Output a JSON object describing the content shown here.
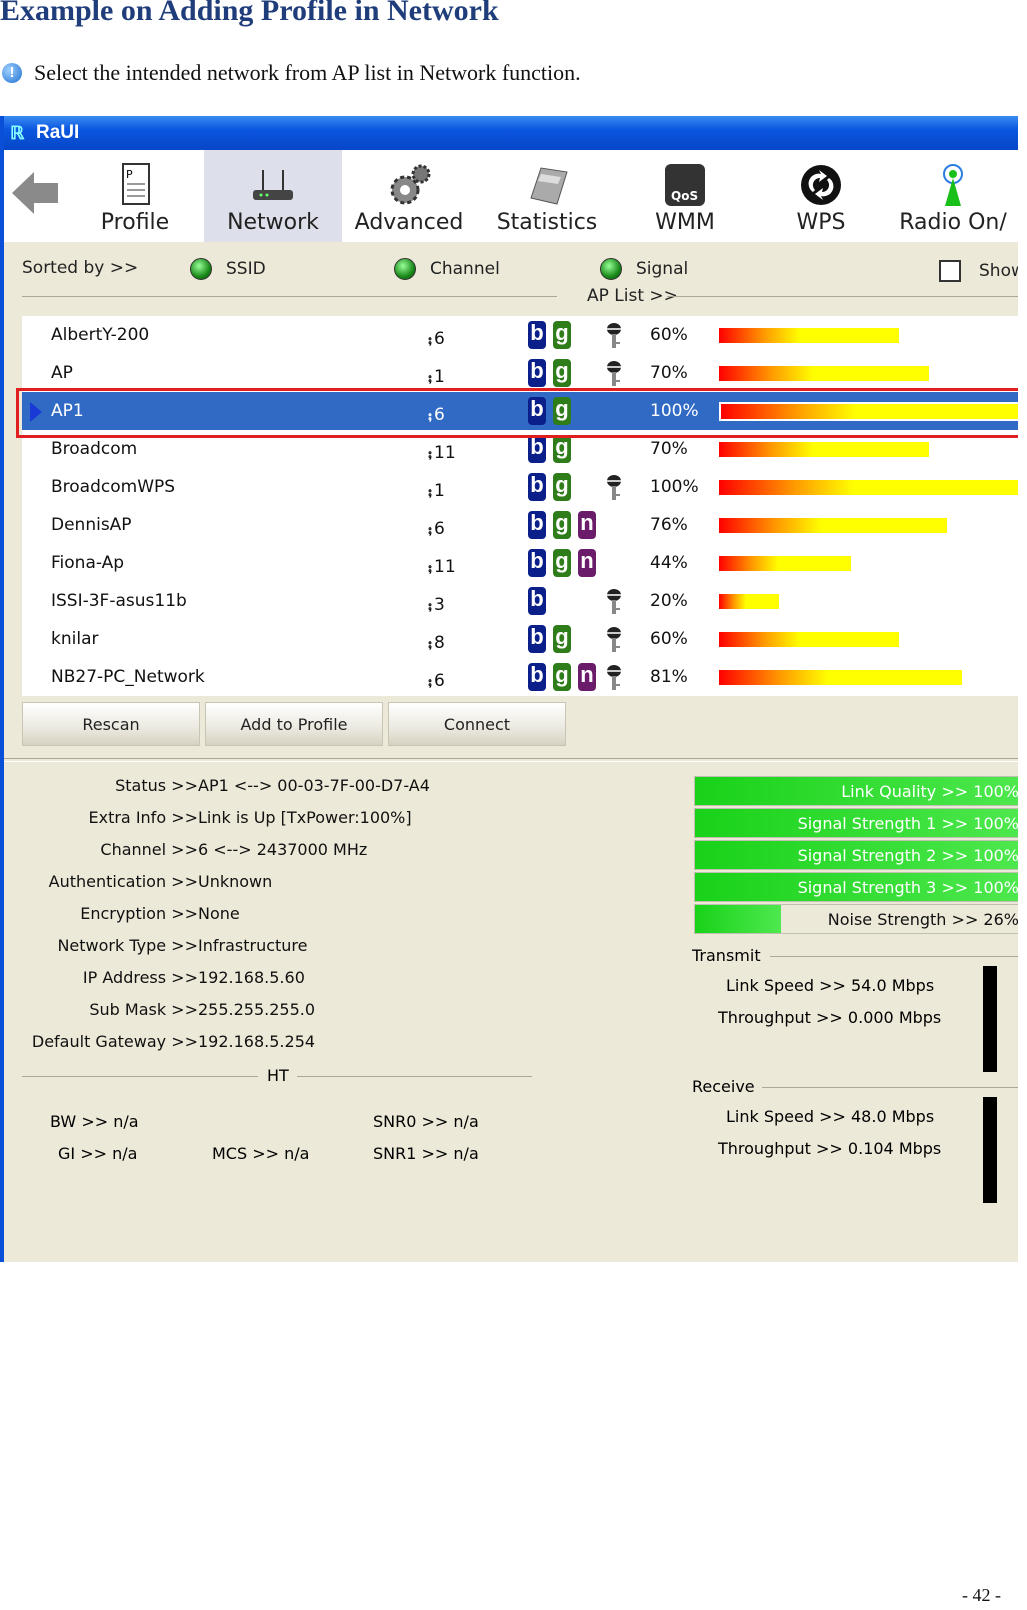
{
  "doc": {
    "title": "Example on Adding Profile in Network",
    "instruction": "Select the intended network from AP list in Network function.",
    "page_number": "- 42 -"
  },
  "window": {
    "title": "RaUI"
  },
  "toolbar": {
    "items": [
      "Profile",
      "Network",
      "Advanced",
      "Statistics",
      "WMM",
      "WPS",
      "Radio On/"
    ]
  },
  "sort": {
    "label": "Sorted by >>",
    "options": [
      "SSID",
      "Channel",
      "Signal"
    ],
    "show_label": "Show",
    "ap_list_label": "AP List >>"
  },
  "aps": [
    {
      "ssid": "AlbertY-200",
      "channel": "6",
      "b": true,
      "g": true,
      "n": false,
      "key": true,
      "signal": "60%",
      "pct": 60
    },
    {
      "ssid": "AP",
      "channel": "1",
      "b": true,
      "g": true,
      "n": false,
      "key": true,
      "signal": "70%",
      "pct": 70
    },
    {
      "ssid": "AP1",
      "channel": "6",
      "b": true,
      "g": true,
      "n": false,
      "key": false,
      "signal": "100%",
      "pct": 100,
      "selected": true
    },
    {
      "ssid": "Broadcom",
      "channel": "11",
      "b": true,
      "g": true,
      "n": false,
      "key": false,
      "signal": "70%",
      "pct": 70
    },
    {
      "ssid": "BroadcomWPS",
      "channel": "1",
      "b": true,
      "g": true,
      "n": false,
      "key": true,
      "signal": "100%",
      "pct": 100
    },
    {
      "ssid": "DennisAP",
      "channel": "6",
      "b": true,
      "g": true,
      "n": true,
      "key": false,
      "signal": "76%",
      "pct": 76
    },
    {
      "ssid": "Fiona-Ap",
      "channel": "11",
      "b": true,
      "g": true,
      "n": true,
      "key": false,
      "signal": "44%",
      "pct": 44
    },
    {
      "ssid": "ISSI-3F-asus11b",
      "channel": "3",
      "b": true,
      "g": false,
      "n": false,
      "key": true,
      "signal": "20%",
      "pct": 20
    },
    {
      "ssid": "knilar",
      "channel": "8",
      "b": true,
      "g": true,
      "n": false,
      "key": true,
      "signal": "60%",
      "pct": 60
    },
    {
      "ssid": "NB27-PC_Network",
      "channel": "6",
      "b": true,
      "g": true,
      "n": true,
      "key": true,
      "signal": "81%",
      "pct": 81
    }
  ],
  "buttons": {
    "rescan": "Rescan",
    "add": "Add to Profile",
    "connect": "Connect"
  },
  "info": [
    {
      "k": "Status >>",
      "v": "AP1 <--> 00-03-7F-00-D7-A4"
    },
    {
      "k": "Extra Info >>",
      "v": "Link is Up  [TxPower:100%]"
    },
    {
      "k": "Channel >>",
      "v": "6 <--> 2437000 MHz"
    },
    {
      "k": "Authentication >>",
      "v": "Unknown"
    },
    {
      "k": "Encryption >>",
      "v": "None"
    },
    {
      "k": "Network Type >>",
      "v": "Infrastructure"
    },
    {
      "k": "IP Address >>",
      "v": "192.168.5.60"
    },
    {
      "k": "Sub Mask >>",
      "v": "255.255.255.0"
    },
    {
      "k": "Default Gateway >>",
      "v": "192.168.5.254"
    }
  ],
  "ht": {
    "label": "HT",
    "bw": "BW >> n/a",
    "gi": "GI >> n/a",
    "mcs": "MCS >> n/a",
    "snr0": "SNR0 >> n/a",
    "snr1": "SNR1 >> n/a"
  },
  "meters": [
    {
      "label": "Link Quality >> 100%",
      "pct": 100
    },
    {
      "label": "Signal Strength 1 >> 100%",
      "pct": 100
    },
    {
      "label": "Signal Strength 2 >> 100%",
      "pct": 100
    },
    {
      "label": "Signal Strength 3 >> 100%",
      "pct": 100
    },
    {
      "label": "Noise Strength >> 26%",
      "pct": 26
    }
  ],
  "transmit": {
    "label": "Transmit",
    "link_speed": "Link Speed >>  54.0 Mbps",
    "throughput": "Throughput >>  0.000 Mbps"
  },
  "receive": {
    "label": "Receive",
    "link_speed": "Link Speed >>  48.0 Mbps",
    "throughput": "Throughput >>  0.104 Mbps"
  },
  "colors": {
    "selected_row": "#316ac5",
    "highlight_box": "#e02020",
    "meter_fill": "#19d219"
  }
}
